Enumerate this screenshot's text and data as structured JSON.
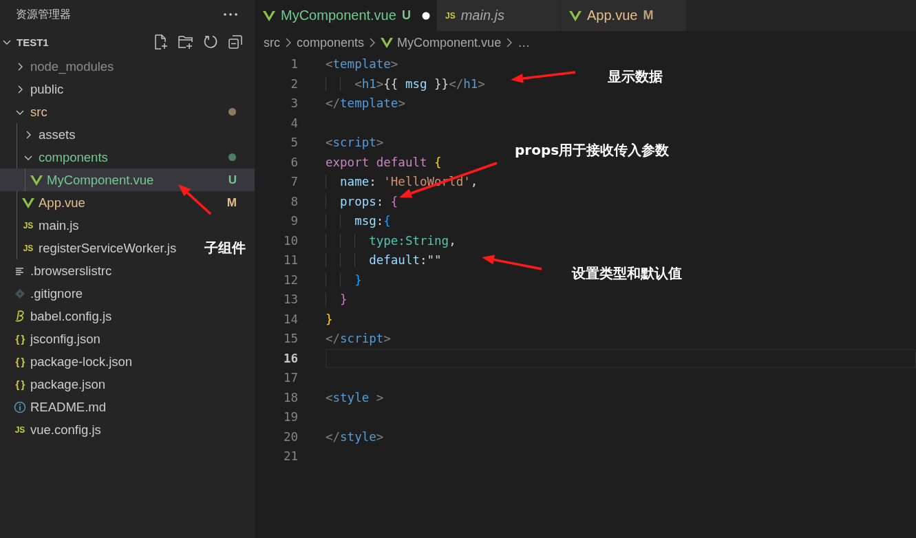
{
  "sidebar": {
    "title": "资源管理器",
    "section": {
      "label": "TEST1",
      "expanded": true
    },
    "tree": [
      {
        "label": "node_modules",
        "kind": "folder",
        "expanded": false,
        "selected": false,
        "color": "#8c8c8c",
        "dot": false
      },
      {
        "label": "public",
        "kind": "folder",
        "expanded": false,
        "selected": false,
        "color": "#cccccc",
        "dot": false
      },
      {
        "label": "src",
        "kind": "folder",
        "expanded": true,
        "selected": false,
        "color": "#e2c08d",
        "dot": true,
        "children": [
          {
            "label": "assets",
            "kind": "folder",
            "expanded": false,
            "selected": false,
            "color": "#cccccc",
            "dot": false
          },
          {
            "label": "components",
            "kind": "folder",
            "expanded": true,
            "selected": false,
            "color": "#73c991",
            "dot": true,
            "children": [
              {
                "label": "MyComponent.vue",
                "kind": "vue",
                "selected": true,
                "color": "#73c991",
                "dot": false,
                "badge": "U"
              }
            ]
          },
          {
            "label": "App.vue",
            "kind": "vue",
            "selected": false,
            "color": "#e2c08d",
            "dot": false,
            "badge": "M"
          },
          {
            "label": "main.js",
            "kind": "js",
            "icon_text": "JS",
            "selected": false,
            "color": "#cccccc",
            "dot": false
          },
          {
            "label": "registerServiceWorker.js",
            "kind": "js",
            "icon_text": "JS",
            "selected": false,
            "color": "#cccccc",
            "dot": false
          }
        ]
      },
      {
        "label": ".browserslistrc",
        "kind": "lines",
        "selected": false,
        "color": "#cccccc",
        "dot": false
      },
      {
        "label": ".gitignore",
        "kind": "git",
        "selected": false,
        "color": "#cccccc",
        "dot": false
      },
      {
        "label": "babel.config.js",
        "kind": "babel",
        "selected": false,
        "color": "#cccccc",
        "dot": false
      },
      {
        "label": "jsconfig.json",
        "kind": "json",
        "icon_text": "{ }",
        "selected": false,
        "color": "#cccccc",
        "dot": false
      },
      {
        "label": "package-lock.json",
        "kind": "json",
        "icon_text": "{ }",
        "selected": false,
        "color": "#cccccc",
        "dot": false
      },
      {
        "label": "package.json",
        "kind": "json",
        "icon_text": "{ }",
        "selected": false,
        "color": "#cccccc",
        "dot": false
      },
      {
        "label": "README.md",
        "kind": "info",
        "selected": false,
        "color": "#cccccc",
        "dot": false
      },
      {
        "label": "vue.config.js",
        "kind": "js",
        "icon_text": "JS",
        "selected": false,
        "color": "#cccccc",
        "dot": false
      }
    ]
  },
  "tabs": [
    {
      "label": "MyComponent.vue",
      "kind": "vue",
      "badge": "U",
      "color": "#73c991",
      "selected": true,
      "preview": false,
      "dirty": true
    },
    {
      "label": "main.js",
      "kind": "js",
      "icon_text": "JS",
      "color": "#a8a8a8",
      "selected": false,
      "preview": true,
      "dirty": false
    },
    {
      "label": "App.vue",
      "kind": "vue",
      "badge": "M",
      "color": "#e2c08d",
      "selected": false,
      "preview": false,
      "dirty": false
    }
  ],
  "breadcrumbs": [
    {
      "label": "src",
      "kind": "folder"
    },
    {
      "label": "components",
      "kind": "folder"
    },
    {
      "label": "MyComponent.vue",
      "kind": "vue"
    },
    {
      "label": "…",
      "kind": "more"
    }
  ],
  "editor": {
    "lines": [
      {
        "number": "1",
        "current": false,
        "tokens": [
          {
            "t": "<",
            "kind": "punct"
          },
          {
            "t": "template",
            "kind": "tag"
          },
          {
            "t": ">",
            "kind": "punct"
          }
        ]
      },
      {
        "number": "2",
        "current": false,
        "tokens": [
          {
            "t": "    <",
            "kind": "punct"
          },
          {
            "t": "h1",
            "kind": "tag"
          },
          {
            "t": ">",
            "kind": "punct"
          },
          {
            "t": "{{ ",
            "kind": "text"
          },
          {
            "t": "msg",
            "kind": "var"
          },
          {
            "t": " }}",
            "kind": "text"
          },
          {
            "t": "</",
            "kind": "punct"
          },
          {
            "t": "h1",
            "kind": "tag"
          },
          {
            "t": ">",
            "kind": "punct"
          }
        ]
      },
      {
        "number": "3",
        "current": false,
        "tokens": [
          {
            "t": "</",
            "kind": "punct"
          },
          {
            "t": "template",
            "kind": "tag"
          },
          {
            "t": ">",
            "kind": "punct"
          }
        ]
      },
      {
        "number": "4",
        "current": false
      },
      {
        "number": "5",
        "current": false,
        "tokens": [
          {
            "t": "<",
            "kind": "punct"
          },
          {
            "t": "script",
            "kind": "tag"
          },
          {
            "t": ">",
            "kind": "punct"
          }
        ]
      },
      {
        "number": "6",
        "current": false,
        "tokens": [
          {
            "t": "export default ",
            "kind": "keyword"
          },
          {
            "t": "{",
            "kind": "brace1"
          }
        ]
      },
      {
        "number": "7",
        "current": false,
        "tokens": [
          {
            "t": "  name",
            "kind": "var"
          },
          {
            "t": ": ",
            "kind": "text"
          },
          {
            "t": "'HelloWorld'",
            "kind": "string"
          },
          {
            "t": ",",
            "kind": "text"
          }
        ]
      },
      {
        "number": "8",
        "current": false,
        "tokens": [
          {
            "t": "  props",
            "kind": "var"
          },
          {
            "t": ": ",
            "kind": "text"
          },
          {
            "t": "{",
            "kind": "brace2"
          }
        ]
      },
      {
        "number": "9",
        "current": false,
        "tokens": [
          {
            "t": "    msg",
            "kind": "var"
          },
          {
            "t": ":",
            "kind": "text"
          },
          {
            "t": "{",
            "kind": "brace3"
          }
        ]
      },
      {
        "number": "10",
        "current": false,
        "tokens": [
          {
            "t": "      type:String",
            "kind": "type"
          },
          {
            "t": ",",
            "kind": "text"
          }
        ]
      },
      {
        "number": "11",
        "current": false,
        "tokens": [
          {
            "t": "      default",
            "kind": "var"
          },
          {
            "t": ":\"\"",
            "kind": "text"
          }
        ]
      },
      {
        "number": "12",
        "current": false,
        "tokens": [
          {
            "t": "    }",
            "kind": "brace3"
          }
        ]
      },
      {
        "number": "13",
        "current": false,
        "tokens": [
          {
            "t": "  }",
            "kind": "brace2"
          }
        ]
      },
      {
        "number": "14",
        "current": false,
        "tokens": [
          {
            "t": "}",
            "kind": "brace1"
          }
        ]
      },
      {
        "number": "15",
        "current": false,
        "tokens": [
          {
            "t": "</",
            "kind": "punct"
          },
          {
            "t": "script",
            "kind": "tag"
          },
          {
            "t": ">",
            "kind": "punct"
          }
        ]
      },
      {
        "number": "16",
        "current": true
      },
      {
        "number": "17",
        "current": false
      },
      {
        "number": "18",
        "current": false,
        "tokens": [
          {
            "t": "<",
            "kind": "punct"
          },
          {
            "t": "style",
            "kind": "tag"
          },
          {
            "t": " >",
            "kind": "punct"
          }
        ]
      },
      {
        "number": "19",
        "current": false
      },
      {
        "number": "20",
        "current": false,
        "tokens": [
          {
            "t": "</",
            "kind": "punct"
          },
          {
            "t": "style",
            "kind": "tag"
          },
          {
            "t": ">",
            "kind": "punct"
          }
        ]
      },
      {
        "number": "21",
        "current": false
      }
    ]
  },
  "annotations": [
    {
      "text": "显示数据"
    },
    {
      "text": "props用于接收传入参数"
    },
    {
      "text": "设置类型和默认值"
    },
    {
      "text": "子组件"
    }
  ]
}
